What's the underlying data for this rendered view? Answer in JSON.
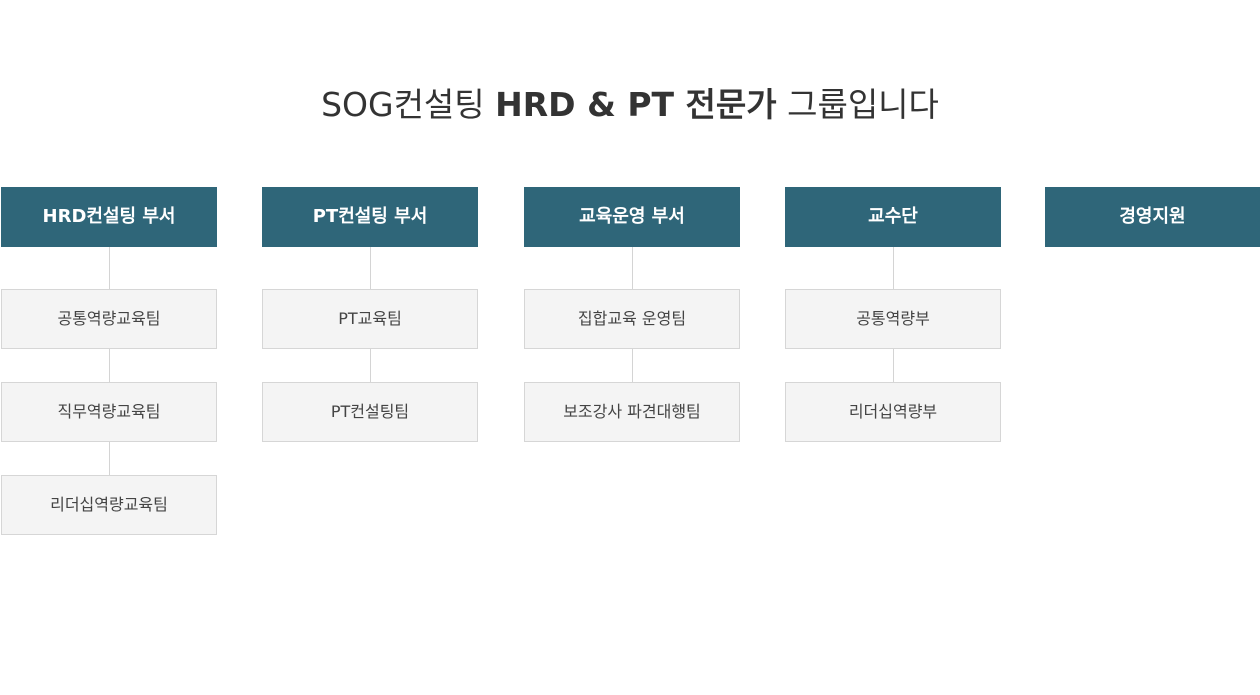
{
  "heading": {
    "prefix": "SOG컨설팅 ",
    "bold": "HRD & PT 전문가",
    "suffix": " 그룹입니다"
  },
  "departments": [
    {
      "name": "HRD컨설팅 부서",
      "teams": [
        "공통역량교육팀",
        "직무역량교육팀",
        "리더십역량교육팀"
      ]
    },
    {
      "name": "PT컨설팅 부서",
      "teams": [
        "PT교육팀",
        "PT컨설팅팀"
      ]
    },
    {
      "name": "교육운영 부서",
      "teams": [
        "집합교육 운영팀",
        "보조강사 파견대행팀"
      ]
    },
    {
      "name": "교수단",
      "teams": [
        "공통역량부",
        "리더십역량부"
      ]
    },
    {
      "name": "경영지원",
      "teams": []
    }
  ],
  "colors": {
    "dept_bg": "#2f6679",
    "team_bg": "#f4f4f4",
    "team_border": "#d6d6d6",
    "connector": "#d4d4d4",
    "heading_text": "#333333"
  }
}
